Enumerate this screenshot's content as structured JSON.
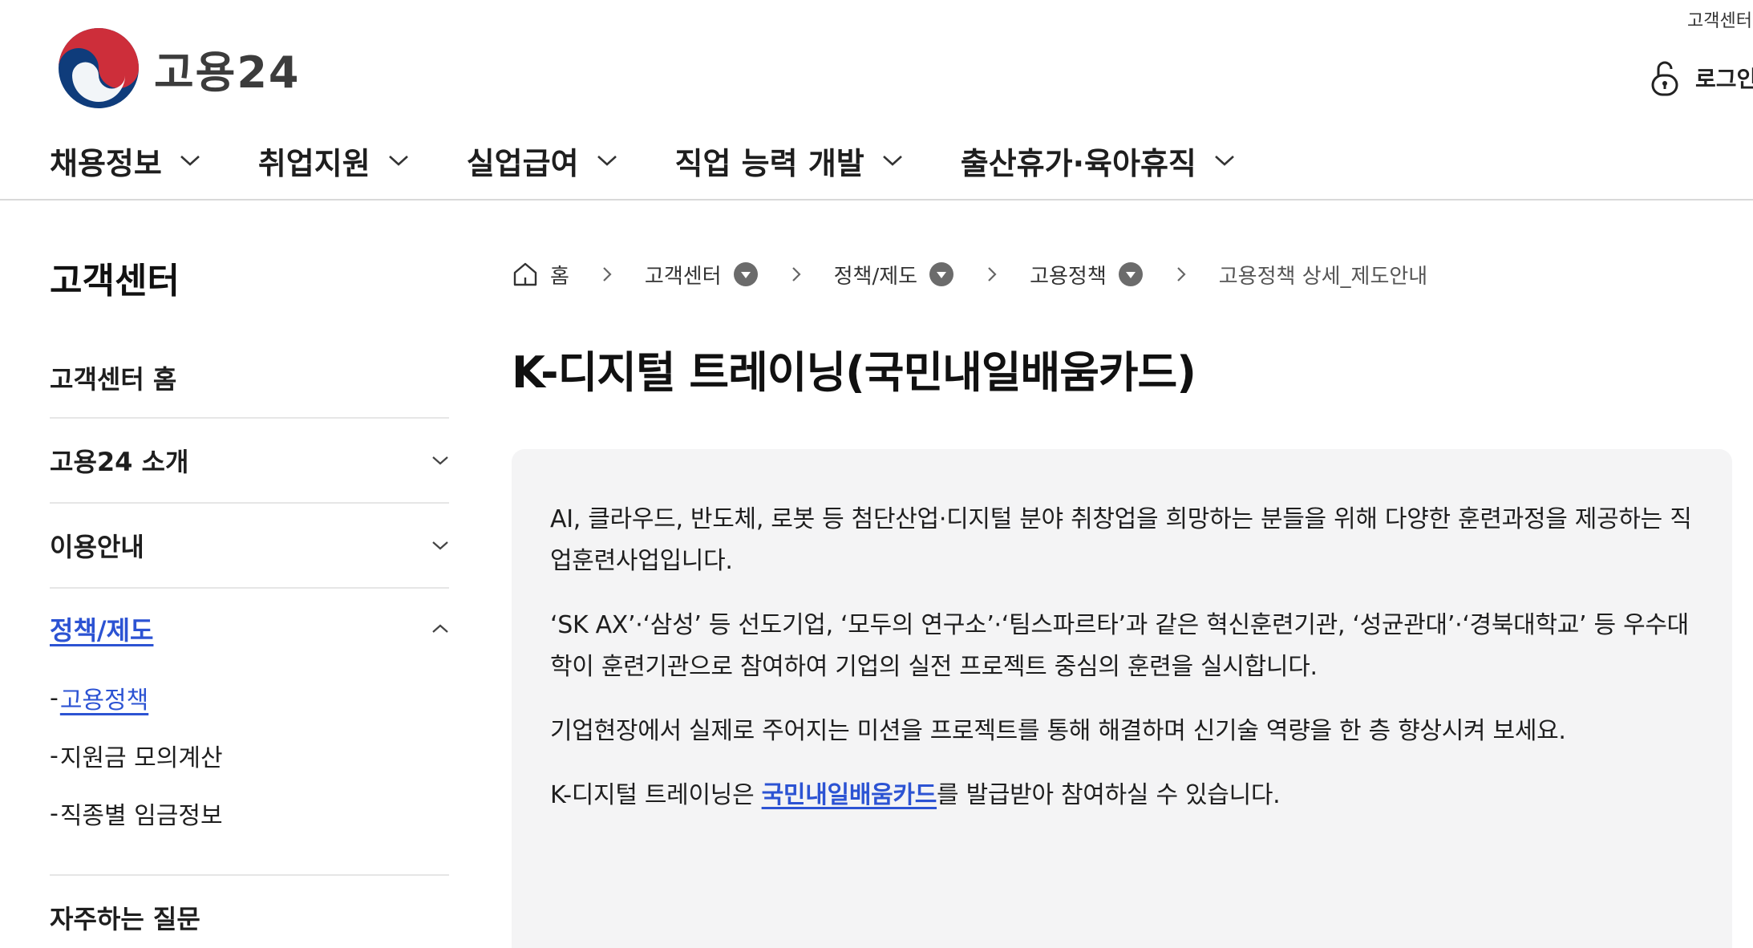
{
  "header": {
    "logo_text": "고용24",
    "util_top": "고객센터",
    "login_label": "로그인",
    "nav": [
      {
        "label": "채용정보"
      },
      {
        "label": "취업지원"
      },
      {
        "label": "실업급여"
      },
      {
        "label": "직업 능력 개발"
      },
      {
        "label": "출산휴가·육아휴직"
      }
    ]
  },
  "sidebar": {
    "title": "고객센터",
    "items": [
      {
        "label": "고객센터 홈"
      },
      {
        "label": "고용24 소개"
      },
      {
        "label": "이용안내"
      },
      {
        "label": "정책/제도"
      },
      {
        "label": "자주하는 질문"
      }
    ],
    "sub_items": [
      {
        "dash": "-",
        "label": "고용정책"
      },
      {
        "dash": "-",
        "label": "지원금 모의계산"
      },
      {
        "dash": "-",
        "label": "직종별 임금정보"
      }
    ]
  },
  "breadcrumb": {
    "home": "홈",
    "items": [
      "고객센터",
      "정책/제도",
      "고용정책"
    ],
    "current": "고용정책 상세_제도안내"
  },
  "page_title": "K-디지털 트레이닝(국민내일배움카드)",
  "content": {
    "p1": "AI, 클라우드, 반도체, 로봇 등 첨단산업·디지털 분야 취창업을 희망하는 분들을 위해 다양한 훈련과정을 제공하는 직업훈련사업입니다.",
    "p2": "‘SK AX’·‘삼성’ 등 선도기업, ‘모두의 연구소’·‘팀스파르타’과 같은 혁신훈련기관, ‘성균관대’·‘경북대학교’ 등 우수대학이 훈련기관으로 참여하여 기업의 실전 프로젝트 중심의 훈련을 실시합니다.",
    "p3": "기업현장에서 실제로 주어지는 미션을 프로젝트를 통해 해결하며 신기술 역량을 한 층 향상시켜 보세요.",
    "p4_before": "K-디지털 트레이닝은 ",
    "p4_link": "국민내일배움카드",
    "p4_after": "를 발급받아 참여하실 수 있습니다."
  },
  "colors": {
    "accent": "#2c53d3",
    "logo_red": "#cd2e3a",
    "logo_blue": "#0f3c7b",
    "content_bg": "#f4f4f5"
  }
}
